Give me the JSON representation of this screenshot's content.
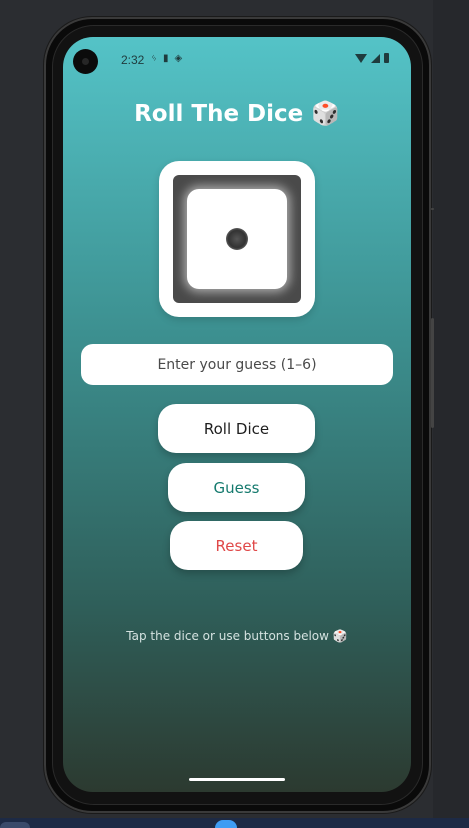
{
  "status_bar": {
    "time": "2:32",
    "left_icons": [
      "notification-icon",
      "sd-card-icon",
      "vpn-icon"
    ],
    "right_icons": [
      "wifi-icon",
      "signal-icon",
      "battery-icon"
    ]
  },
  "app": {
    "title": "Roll The Dice 🎲",
    "dice_value": 1,
    "guess_input": {
      "value": "",
      "placeholder": "Enter your guess (1–6)"
    },
    "buttons": {
      "roll": "Roll Dice",
      "guess": "Guess",
      "reset": "Reset"
    },
    "hint": "Tap the dice or use buttons below 🎲"
  },
  "colors": {
    "gradient_top": "#54c3c7",
    "gradient_bottom": "#2c3a30",
    "guess_text": "#157a6e",
    "reset_text": "#e04848"
  }
}
